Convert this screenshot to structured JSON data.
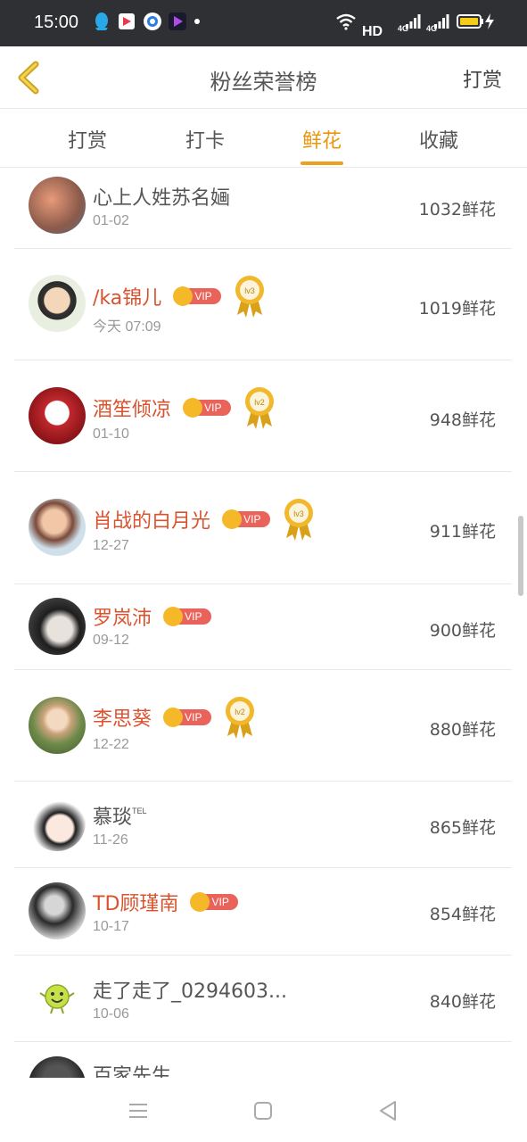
{
  "status_bar": {
    "time": "15:00",
    "network_label": "HD",
    "signal1": "4G",
    "signal2": "4G"
  },
  "header": {
    "title": "粉丝荣誉榜",
    "right_action": "打赏"
  },
  "tabs": [
    {
      "label": "打赏",
      "active": false
    },
    {
      "label": "打卡",
      "active": false
    },
    {
      "label": "鲜花",
      "active": true
    },
    {
      "label": "收藏",
      "active": false
    }
  ],
  "rows": [
    {
      "name": "心上人姓苏名婳",
      "vip": false,
      "medal": "",
      "date": "01-02",
      "score": "1032鲜花"
    },
    {
      "name": "/ka锦儿",
      "vip": true,
      "vip_label": "VIP",
      "medal": "lv3",
      "date": "今天 07:09",
      "score": "1019鲜花"
    },
    {
      "name": "酒笙倾凉",
      "vip": true,
      "vip_label": "VIP",
      "medal": "lv2",
      "date": "01-10",
      "score": "948鲜花"
    },
    {
      "name": "肖战的白月光",
      "vip": true,
      "vip_label": "VIP",
      "medal": "lv3",
      "date": "12-27",
      "score": "911鲜花"
    },
    {
      "name": "罗岚沛",
      "vip": true,
      "vip_label": "VIP",
      "medal": "",
      "date": "09-12",
      "score": "900鲜花"
    },
    {
      "name": "李思葵",
      "vip": true,
      "vip_label": "VIP",
      "medal": "lv2",
      "date": "12-22",
      "score": "880鲜花"
    },
    {
      "name": "慕琰",
      "name_suffix": "TEL",
      "vip": false,
      "medal": "",
      "date": "11-26",
      "score": "865鲜花"
    },
    {
      "name": "TD顾瑾南",
      "vip": true,
      "vip_label": "VIP",
      "medal": "",
      "date": "10-17",
      "score": "854鲜花"
    },
    {
      "name": "走了走了_0294603...",
      "vip": false,
      "medal": "",
      "date": "10-06",
      "score": "840鲜花"
    },
    {
      "name": "百家先生",
      "vip": false,
      "medal": "",
      "date": "",
      "score": ""
    }
  ],
  "colors": {
    "accent": "#f0a020",
    "vip_name": "#d9532f",
    "vip_pill": "#e9635a",
    "crown": "#f5b829"
  }
}
